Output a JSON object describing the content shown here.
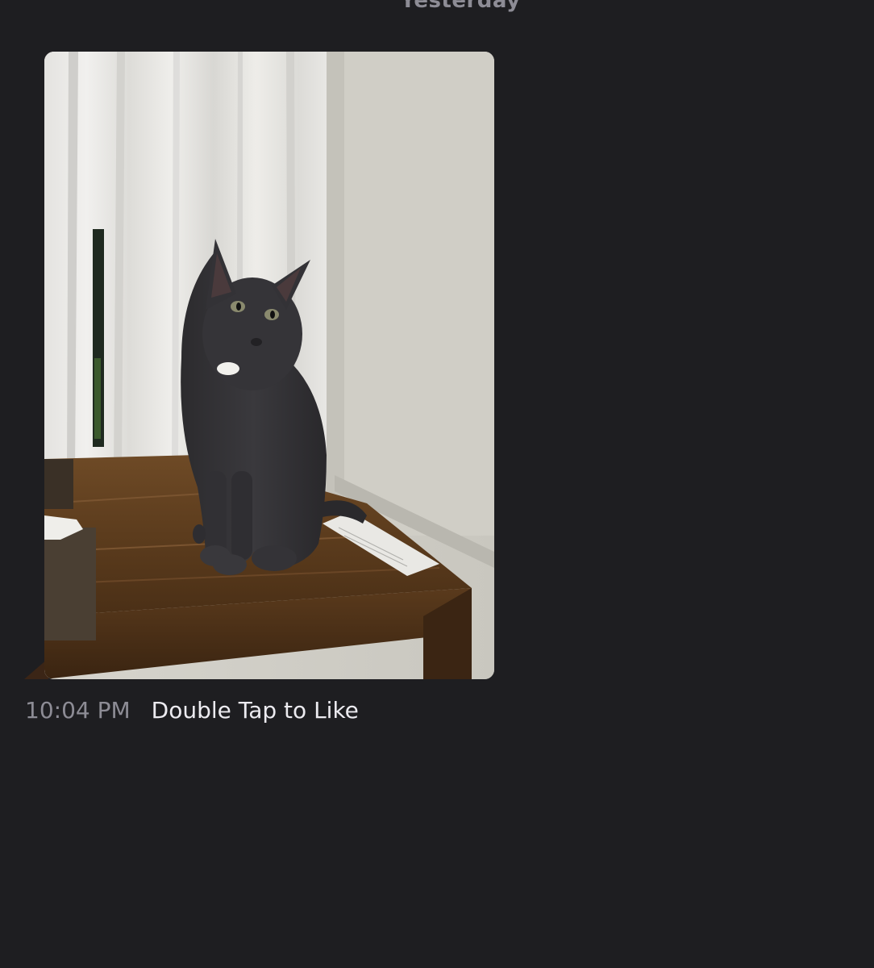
{
  "thread": {
    "date_separator": "Yesterday"
  },
  "message": {
    "photo_subject": "cat-photo",
    "timestamp": "10:04 PM",
    "like_hint": "Double Tap to Like"
  },
  "colors": {
    "background": "#1e1e21",
    "muted_text": "#8d8c95",
    "primary_text": "#ecebf0"
  }
}
